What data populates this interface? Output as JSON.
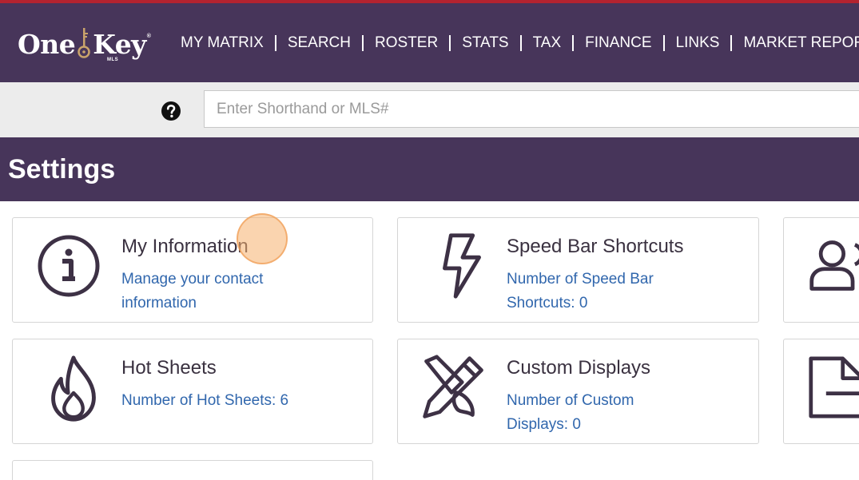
{
  "header": {
    "logo_word1": "One",
    "logo_word2": "Key",
    "logo_reg": "®",
    "logo_sub": "MLS",
    "nav": [
      "MY MATRIX",
      "SEARCH",
      "ROSTER",
      "STATS",
      "TAX",
      "FINANCE",
      "LINKS",
      "MARKET REPORTS"
    ]
  },
  "search": {
    "placeholder": "Enter Shorthand or MLS#",
    "help_icon": "question-circle-icon"
  },
  "page": {
    "title": "Settings"
  },
  "cards": [
    {
      "title": "My Information",
      "sub": "Manage your contact information",
      "icon": "info-circle-icon"
    },
    {
      "title": "Speed Bar Shortcuts",
      "sub": "Number of Speed Bar Shortcuts: 0",
      "icon": "lightning-bolt-icon"
    },
    {
      "title": "",
      "sub": "",
      "icon": "users-icon"
    },
    {
      "title": "Hot Sheets",
      "sub": "Number of Hot Sheets: 6",
      "icon": "flame-icon"
    },
    {
      "title": "Custom Displays",
      "sub": "Number of Custom Displays: 0",
      "icon": "pencil-ruler-icon"
    },
    {
      "title": "",
      "sub": "",
      "icon": "document-icon"
    }
  ],
  "colors": {
    "brand": "#47355a",
    "link": "#3167ad",
    "accent_strip": "#b3232f",
    "icon_stroke": "#3d3145"
  }
}
